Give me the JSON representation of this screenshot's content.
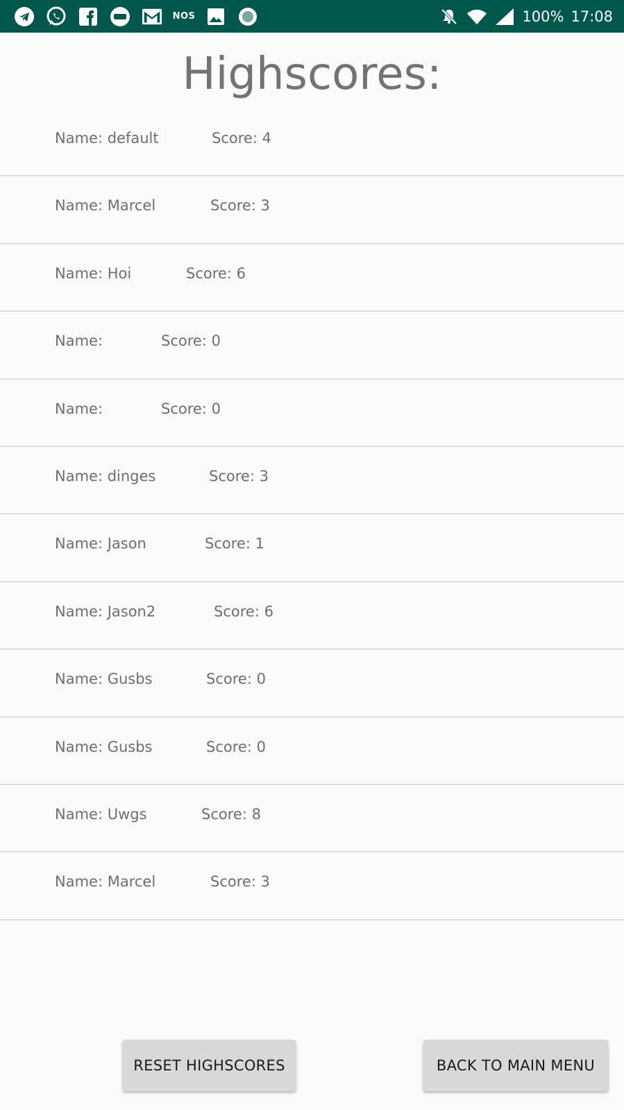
{
  "status_bar": {
    "notification_icons": [
      "telegram-icon",
      "whatsapp-icon",
      "facebook-icon",
      "nu-icon",
      "gmail-icon",
      "nos-icon",
      "image-icon",
      "record-icon"
    ],
    "nos_label": "NOS",
    "battery": "100%",
    "time": "17:08",
    "colors": {
      "background": "#00574b"
    }
  },
  "page": {
    "title": "Highscores:"
  },
  "highscores": [
    {
      "name": "Name: default",
      "score": "Score: 4"
    },
    {
      "name": "Name: Marcel",
      "score": "Score: 3"
    },
    {
      "name": "Name: Hoi",
      "score": "Score: 6"
    },
    {
      "name": "Name:",
      "score": "Score: 0"
    },
    {
      "name": "Name:",
      "score": "Score: 0"
    },
    {
      "name": "Name: dinges",
      "score": "Score: 3"
    },
    {
      "name": "Name: Jason",
      "score": "Score: 1"
    },
    {
      "name": "Name: Jason2",
      "score": "Score: 6"
    },
    {
      "name": "Name: Gusbs",
      "score": "Score: 0"
    },
    {
      "name": "Name: Gusbs",
      "score": "Score: 0"
    },
    {
      "name": "Name: Uwgs",
      "score": "Score: 8"
    },
    {
      "name": "Name: Marcel",
      "score": "Score: 3"
    }
  ],
  "buttons": {
    "reset_label": "RESET HIGHSCORES",
    "back_label": "BACK TO MAIN MENU"
  }
}
